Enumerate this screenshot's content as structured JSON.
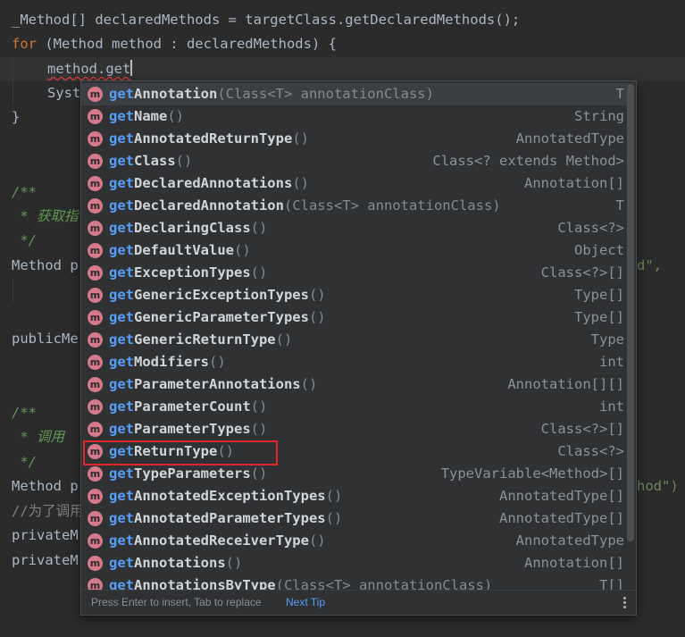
{
  "code": {
    "l0": {
      "a": "_Method[] declaredMethods = targetClass.getDeclaredMethods();"
    },
    "l1": {
      "kw": "for",
      "rest": " (Method method : declaredMethods) {"
    },
    "l2": {
      "text": "method.get"
    },
    "l3": {
      "text": "Syst"
    },
    "l4": {
      "text": "}"
    },
    "l5": {
      "text": "/**"
    },
    "l6": {
      "text": " * 获取指"
    },
    "l7": {
      "text": " */"
    },
    "l8": {
      "a": "Method p",
      "b": "d\","
    },
    "l9": {
      "text": "publicMe"
    },
    "l10": {
      "text": "/**"
    },
    "l11": {
      "text": " * 调用 "
    },
    "l12": {
      "text": " */"
    },
    "l13": {
      "a": "Method p",
      "b": "hod\")"
    },
    "l14": {
      "text": "//为了调用"
    },
    "l15": {
      "text": "privateM"
    },
    "l16": {
      "text": "privateM"
    }
  },
  "completion": {
    "prefix": "get",
    "items": [
      {
        "name": "Annotation",
        "params": "(Class<T> annotationClass)",
        "type": "T"
      },
      {
        "name": "Name",
        "params": "()",
        "type": "String"
      },
      {
        "name": "AnnotatedReturnType",
        "params": "()",
        "type": "AnnotatedType"
      },
      {
        "name": "Class",
        "params": "()",
        "type": "Class<? extends Method>"
      },
      {
        "name": "DeclaredAnnotations",
        "params": "()",
        "type": "Annotation[]"
      },
      {
        "name": "DeclaredAnnotation",
        "params": "(Class<T> annotationClass)",
        "type": "T"
      },
      {
        "name": "DeclaringClass",
        "params": "()",
        "type": "Class<?>"
      },
      {
        "name": "DefaultValue",
        "params": "()",
        "type": "Object"
      },
      {
        "name": "ExceptionTypes",
        "params": "()",
        "type": "Class<?>[]"
      },
      {
        "name": "GenericExceptionTypes",
        "params": "()",
        "type": "Type[]"
      },
      {
        "name": "GenericParameterTypes",
        "params": "()",
        "type": "Type[]"
      },
      {
        "name": "GenericReturnType",
        "params": "()",
        "type": "Type"
      },
      {
        "name": "Modifiers",
        "params": "()",
        "type": "int"
      },
      {
        "name": "ParameterAnnotations",
        "params": "()",
        "type": "Annotation[][]"
      },
      {
        "name": "ParameterCount",
        "params": "()",
        "type": "int"
      },
      {
        "name": "ParameterTypes",
        "params": "()",
        "type": "Class<?>[]"
      },
      {
        "name": "ReturnType",
        "params": "()",
        "type": "Class<?>"
      },
      {
        "name": "TypeParameters",
        "params": "()",
        "type": "TypeVariable<Method>[]"
      },
      {
        "name": "AnnotatedExceptionTypes",
        "params": "()",
        "type": "AnnotatedType[]"
      },
      {
        "name": "AnnotatedParameterTypes",
        "params": "()",
        "type": "AnnotatedType[]"
      },
      {
        "name": "AnnotatedReceiverType",
        "params": "()",
        "type": "AnnotatedType"
      },
      {
        "name": "Annotations",
        "params": "()",
        "type": "Annotation[]"
      },
      {
        "name": "AnnotationsByType",
        "params": "(Class<T> annotationClass)",
        "type": "T[]"
      }
    ],
    "icon_letter": "m",
    "highlighted_item": "ReturnType",
    "footer_text": "Press Enter to insert, Tab to replace",
    "footer_link": "Next Tip"
  },
  "colors": {
    "background": "#2b2b2b",
    "keyword": "#cc7832",
    "match": "#589df6",
    "method_icon": "#d67a8a",
    "highlight_box": "#e0272a"
  }
}
